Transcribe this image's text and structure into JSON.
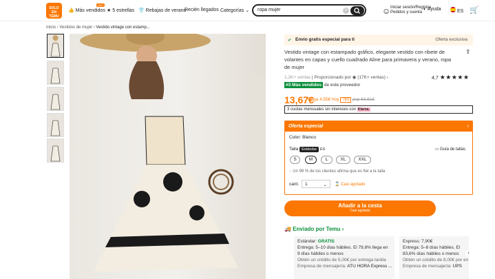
{
  "header": {
    "logo_line1": "SOLO",
    "logo_line2": "EN",
    "logo_line3": "TEMU",
    "best_sellers": "Más vendidos",
    "hot_badge": "HOT",
    "five_stars": "5 estrellas",
    "summer_sale": "Rebajas de verano",
    "new_arrivals": "Recién llegados",
    "categories": "Categorías",
    "search_value": "ropa mujer",
    "signin_line1": "Iniciar sesión/Registra",
    "signin_line2": "Pedidos y cuenta",
    "help": "Ayuda",
    "lang": "ES"
  },
  "breadcrumb": {
    "home": "Inicio",
    "women": "Vestidos de mujer",
    "current": "Vestido vintage con estamp..."
  },
  "product": {
    "ship_banner": "Envío gratis especial para ti",
    "exclusive": "Oferta exclusiva",
    "title": "Vestido vintage con estampado gráfico, elegante vestido con ribete de volantes en capas y cuello cuadrado Aline para primavera y verano, ropa de mujer",
    "sold": "1,2K+ ventas",
    "provided_by": "Proporcionado por",
    "provider_sales": "(17K+ ventas)",
    "rating": "4,7",
    "rank_badge": "#3 Más vendidos",
    "rank_text": "de este proveedor",
    "price": "13,67€",
    "pay_today": "Paga 4,55€ hoy",
    "discount": "-78%",
    "rrp": "pvp 63,61€",
    "installments": "3 cuotas mensuales sin intereses con",
    "klarna": "Klarna.",
    "special_offer": "Oferta especial",
    "color_label": "Color: Blanco",
    "size_label": "Talla",
    "size_tab_std": "Estándar",
    "size_tab_es": "ES",
    "size_guide": "Guía de tallas",
    "sizes": [
      "S",
      "M",
      "L",
      "XL",
      "XXL"
    ],
    "fit_text": "Un 99 % de los clientes afirma que es fiel a la talla",
    "qty_label": "cant.",
    "qty": "1",
    "almost_sold": "Casi agotado",
    "add_cart": "Añadir a la cesta",
    "add_cart_sub": "Casi agotado",
    "sent_by": "Enviado por Temu",
    "std_title": "Estándar:",
    "std_free": "GRATIS",
    "std_eta": "Entrega: 5–10 días hábiles. El 79,8% llega en 9 días hábiles o menos",
    "std_credit": "Obtén un crédito de 5,00€ por entrega tardía",
    "std_courier": "Empresa de mensajería:",
    "std_courier_name": "ATU HORA Express ...",
    "exp_title": "Express:",
    "exp_price": "7,90€",
    "exp_eta": "Entrega: 5–8 días hábiles. El 83,6% días hábiles o menos",
    "exp_credit": "Obtén un crédito de 8,00€ por en",
    "exp_courier": "Empresa de mensajería:",
    "exp_courier_name": "UPS"
  }
}
